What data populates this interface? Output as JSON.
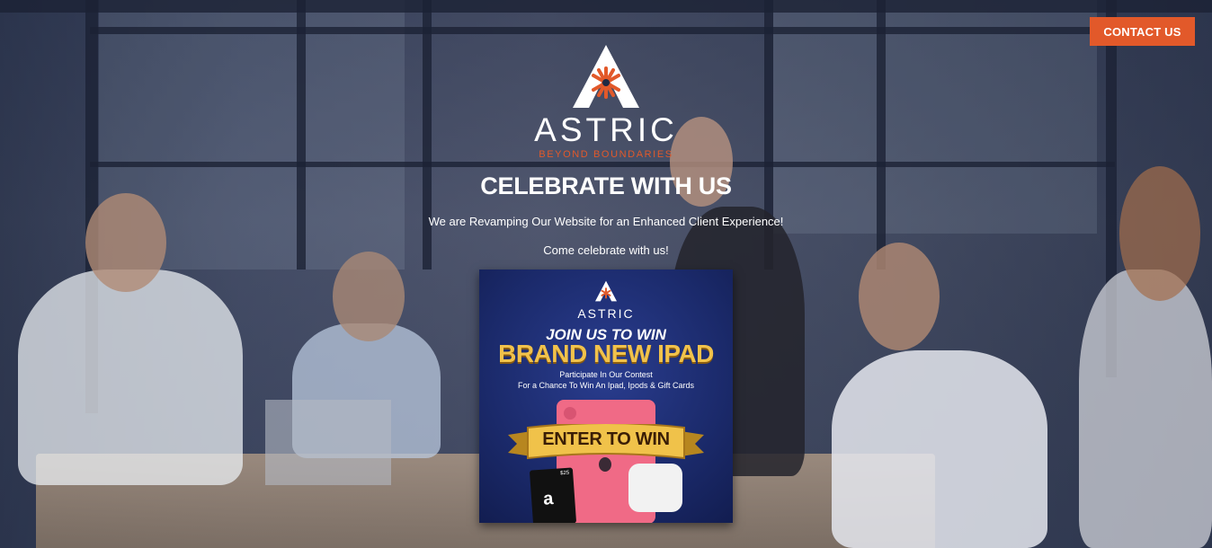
{
  "header": {
    "contact_label": "CONTACT US"
  },
  "logo": {
    "brand": "ASTRIC",
    "tagline": "BEYOND BOUNDARIES"
  },
  "hero": {
    "headline": "CELEBRATE WITH US",
    "line1": "We are Revamping Our Website for an Enhanced Client Experience!",
    "line2": "Come celebrate with us!"
  },
  "promo": {
    "brand": "ASTRIC",
    "join": "JOIN US TO WIN",
    "title": "BRAND NEW IPAD",
    "line1": "Participate In Our Contest",
    "line2": "For a Chance To Win An Ipad, Ipods & Gift Cards",
    "cta": "ENTER TO WIN",
    "giftcard_logo": "a",
    "giftcard_value": "$25"
  },
  "colors": {
    "accent": "#e2592a",
    "gold": "#f1c24b",
    "promo_blue": "#1b2a6b"
  }
}
